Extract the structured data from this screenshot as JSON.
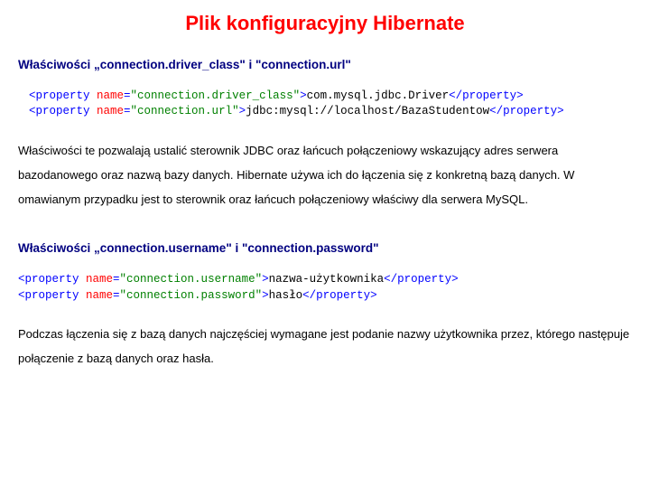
{
  "title": "Plik konfiguracyjny Hibernate",
  "section1": {
    "heading": "Właściwości „connection.driver_class\" i \"connection.url\"",
    "code": {
      "line1": {
        "openTag": "<property ",
        "attrName": "name",
        "eq": "=",
        "attrValue": "\"connection.driver_class\"",
        "closeOpen": ">",
        "content": "com.mysql.jdbc.Driver",
        "closeTag": "</property>"
      },
      "line2": {
        "openTag": "<property ",
        "attrName": "name",
        "eq": "=",
        "attrValue": "\"connection.url\"",
        "closeOpen": ">",
        "content": "jdbc:mysql://localhost/BazaStudentow",
        "closeTag": "</property>"
      }
    },
    "paragraph": "Właściwości te pozwalają ustalić sterownik JDBC oraz łańcuch połączeniowy wskazujący adres serwera bazodanowego oraz nazwą bazy danych. Hibernate używa ich do łączenia się z konkretną bazą danych. W omawianym przypadku jest to sterownik oraz łańcuch połączeniowy właściwy dla serwera MySQL."
  },
  "section2": {
    "heading": "Właściwości „connection.username\" i \"connection.password\"",
    "code": {
      "line1": {
        "openTag": "<property ",
        "attrName": "name",
        "eq": "=",
        "attrValue": "\"connection.username\"",
        "closeOpen": ">",
        "content": "nazwa-użytkownika",
        "closeTag": "</property>"
      },
      "line2": {
        "openTag": "<property ",
        "attrName": "name",
        "eq": "=",
        "attrValue": "\"connection.password\"",
        "closeOpen": ">",
        "content": "hasło",
        "closeTag": "</property>"
      }
    },
    "paragraph": "Podczas łączenia się z bazą danych najczęściej wymagane jest podanie nazwy użytkownika przez, którego następuje połączenie z bazą danych oraz hasła."
  }
}
